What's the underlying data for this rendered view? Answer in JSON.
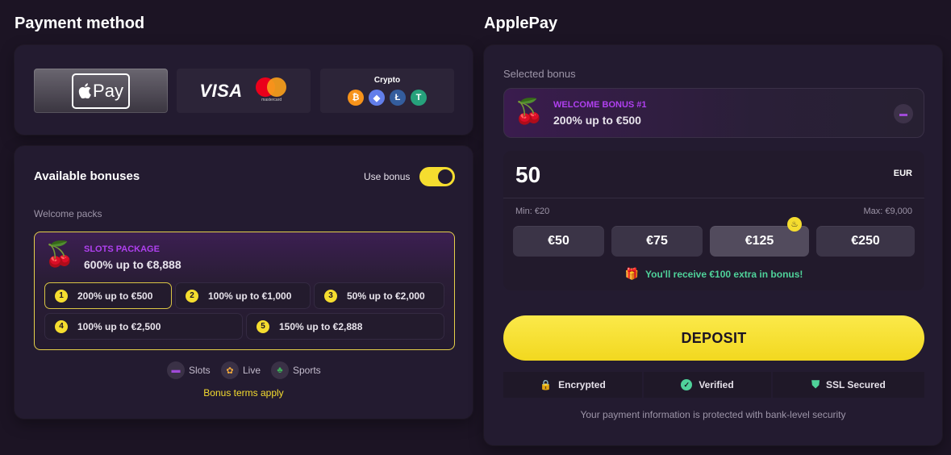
{
  "left": {
    "title": "Payment method",
    "methods": {
      "apple": "Pay",
      "visa": "VISA",
      "mastercard": "mastercard",
      "crypto_label": "Crypto"
    },
    "bonuses": {
      "title": "Available bonuses",
      "toggle_label": "Use bonus",
      "toggle_on": true,
      "section_label": "Welcome packs",
      "package": {
        "name": "SLOTS PACKAGE",
        "offer": "600% up to €8,888",
        "tiers": [
          {
            "num": "1",
            "label": "200% up to €500"
          },
          {
            "num": "2",
            "label": "100% up to €1,000"
          },
          {
            "num": "3",
            "label": "50% up to €2,000"
          },
          {
            "num": "4",
            "label": "100% up to €2,500"
          },
          {
            "num": "5",
            "label": "150% up to €2,888"
          }
        ]
      },
      "categories": [
        {
          "label": "Slots",
          "icon": "slots-icon"
        },
        {
          "label": "Live",
          "icon": "live-icon"
        },
        {
          "label": "Sports",
          "icon": "sports-icon"
        }
      ],
      "terms": "Bonus terms apply"
    }
  },
  "right": {
    "title": "ApplePay",
    "selected_label": "Selected bonus",
    "selected_bonus": {
      "name": "WELCOME BONUS #1",
      "offer": "200% up to €500"
    },
    "amount": "50",
    "currency": "EUR",
    "min": "Min: €20",
    "max": "Max: €9,000",
    "chips": [
      "€50",
      "€75",
      "€125",
      "€250"
    ],
    "extra": "You'll receive €100 extra in bonus!",
    "deposit": "DEPOSIT",
    "security": [
      "Encrypted",
      "Verified",
      "SSL Secured"
    ],
    "note": "Your payment information is protected with bank-level security"
  },
  "colors": {
    "background": "#1c1424",
    "accent_yellow": "#f5dd2f",
    "accent_purple": "#b040f0",
    "success_green": "#4fd29a"
  }
}
